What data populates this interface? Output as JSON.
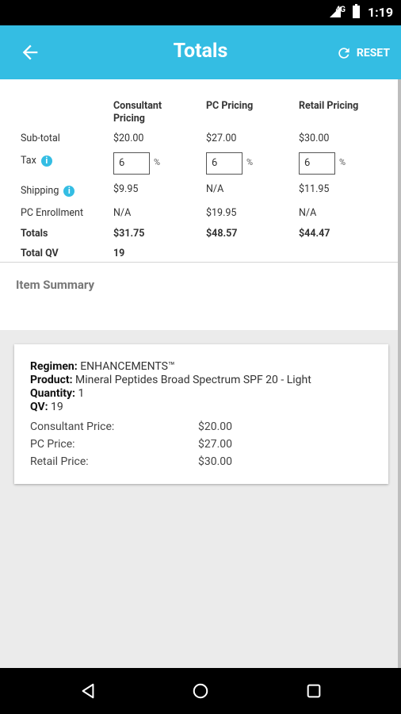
{
  "status_bar": {
    "time": "1:19",
    "network": "4G"
  },
  "app_bar": {
    "title": "Totals",
    "reset_label": "RESET"
  },
  "totals": {
    "columns": [
      "Consultant\nPricing",
      "PC Pricing",
      "Retail Pricing"
    ],
    "rows": {
      "subtotal": {
        "label": "Sub-total",
        "values": [
          "$20.00",
          "$27.00",
          "$30.00"
        ]
      },
      "tax": {
        "label": "Tax",
        "values": [
          "6",
          "6",
          "6"
        ],
        "unit": "%"
      },
      "shipping": {
        "label": "Shipping",
        "values": [
          "$9.95",
          "N/A",
          "$11.95"
        ]
      },
      "pc_enrollment": {
        "label": "PC Enrollment",
        "values": [
          "N/A",
          "$19.95",
          "N/A"
        ]
      },
      "totals": {
        "label": "Totals",
        "values": [
          "$31.75",
          "$48.57",
          "$44.47"
        ]
      },
      "total_qv": {
        "label": "Total QV",
        "values": [
          "19"
        ]
      }
    }
  },
  "item_summary": {
    "heading": "Item Summary",
    "item": {
      "regimen_label": "Regimen:",
      "regimen": "ENHANCEMENTS™",
      "product_label": "Product:",
      "product": "Mineral Peptides Broad Spectrum SPF 20 - Light",
      "quantity_label": "Quantity:",
      "quantity": "1",
      "qv_label": "QV:",
      "qv": "19",
      "consultant_price_label": "Consultant Price:",
      "consultant_price": "$20.00",
      "pc_price_label": "PC Price:",
      "pc_price": "$27.00",
      "retail_price_label": "Retail Price:",
      "retail_price": "$30.00"
    }
  },
  "colors": {
    "primary": "#34bde3",
    "background": "#ebebeb"
  }
}
